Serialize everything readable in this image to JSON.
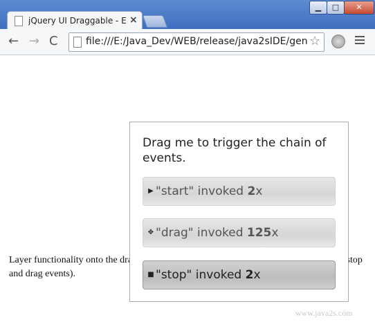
{
  "browser": {
    "tab_title": "jQuery UI Draggable - Even",
    "tab_close": "×",
    "url": "file:///E:/Java_Dev/WEB/release/java2sIDE/gen",
    "window_min": "▁",
    "window_max": "□",
    "window_close": "✕",
    "back": "←",
    "forward": "→",
    "reload": "C",
    "star": "☆"
  },
  "page": {
    "paragraph": "Layer functionality onto the draggable when event start is fired at the start of the drag (stop and drag events).",
    "draggable_message": "Drag me to trigger the chain of events.",
    "events": [
      {
        "icon": "▶",
        "text_before": "\"start\" invoked ",
        "count": "2",
        "suffix": "x"
      },
      {
        "icon": "✥",
        "text_before": "\"drag\" invoked ",
        "count": "125",
        "suffix": "x"
      },
      {
        "icon": "■",
        "text_before": "\"stop\" invoked ",
        "count": "2",
        "suffix": "x"
      }
    ],
    "watermark": "www.java2s.com"
  }
}
